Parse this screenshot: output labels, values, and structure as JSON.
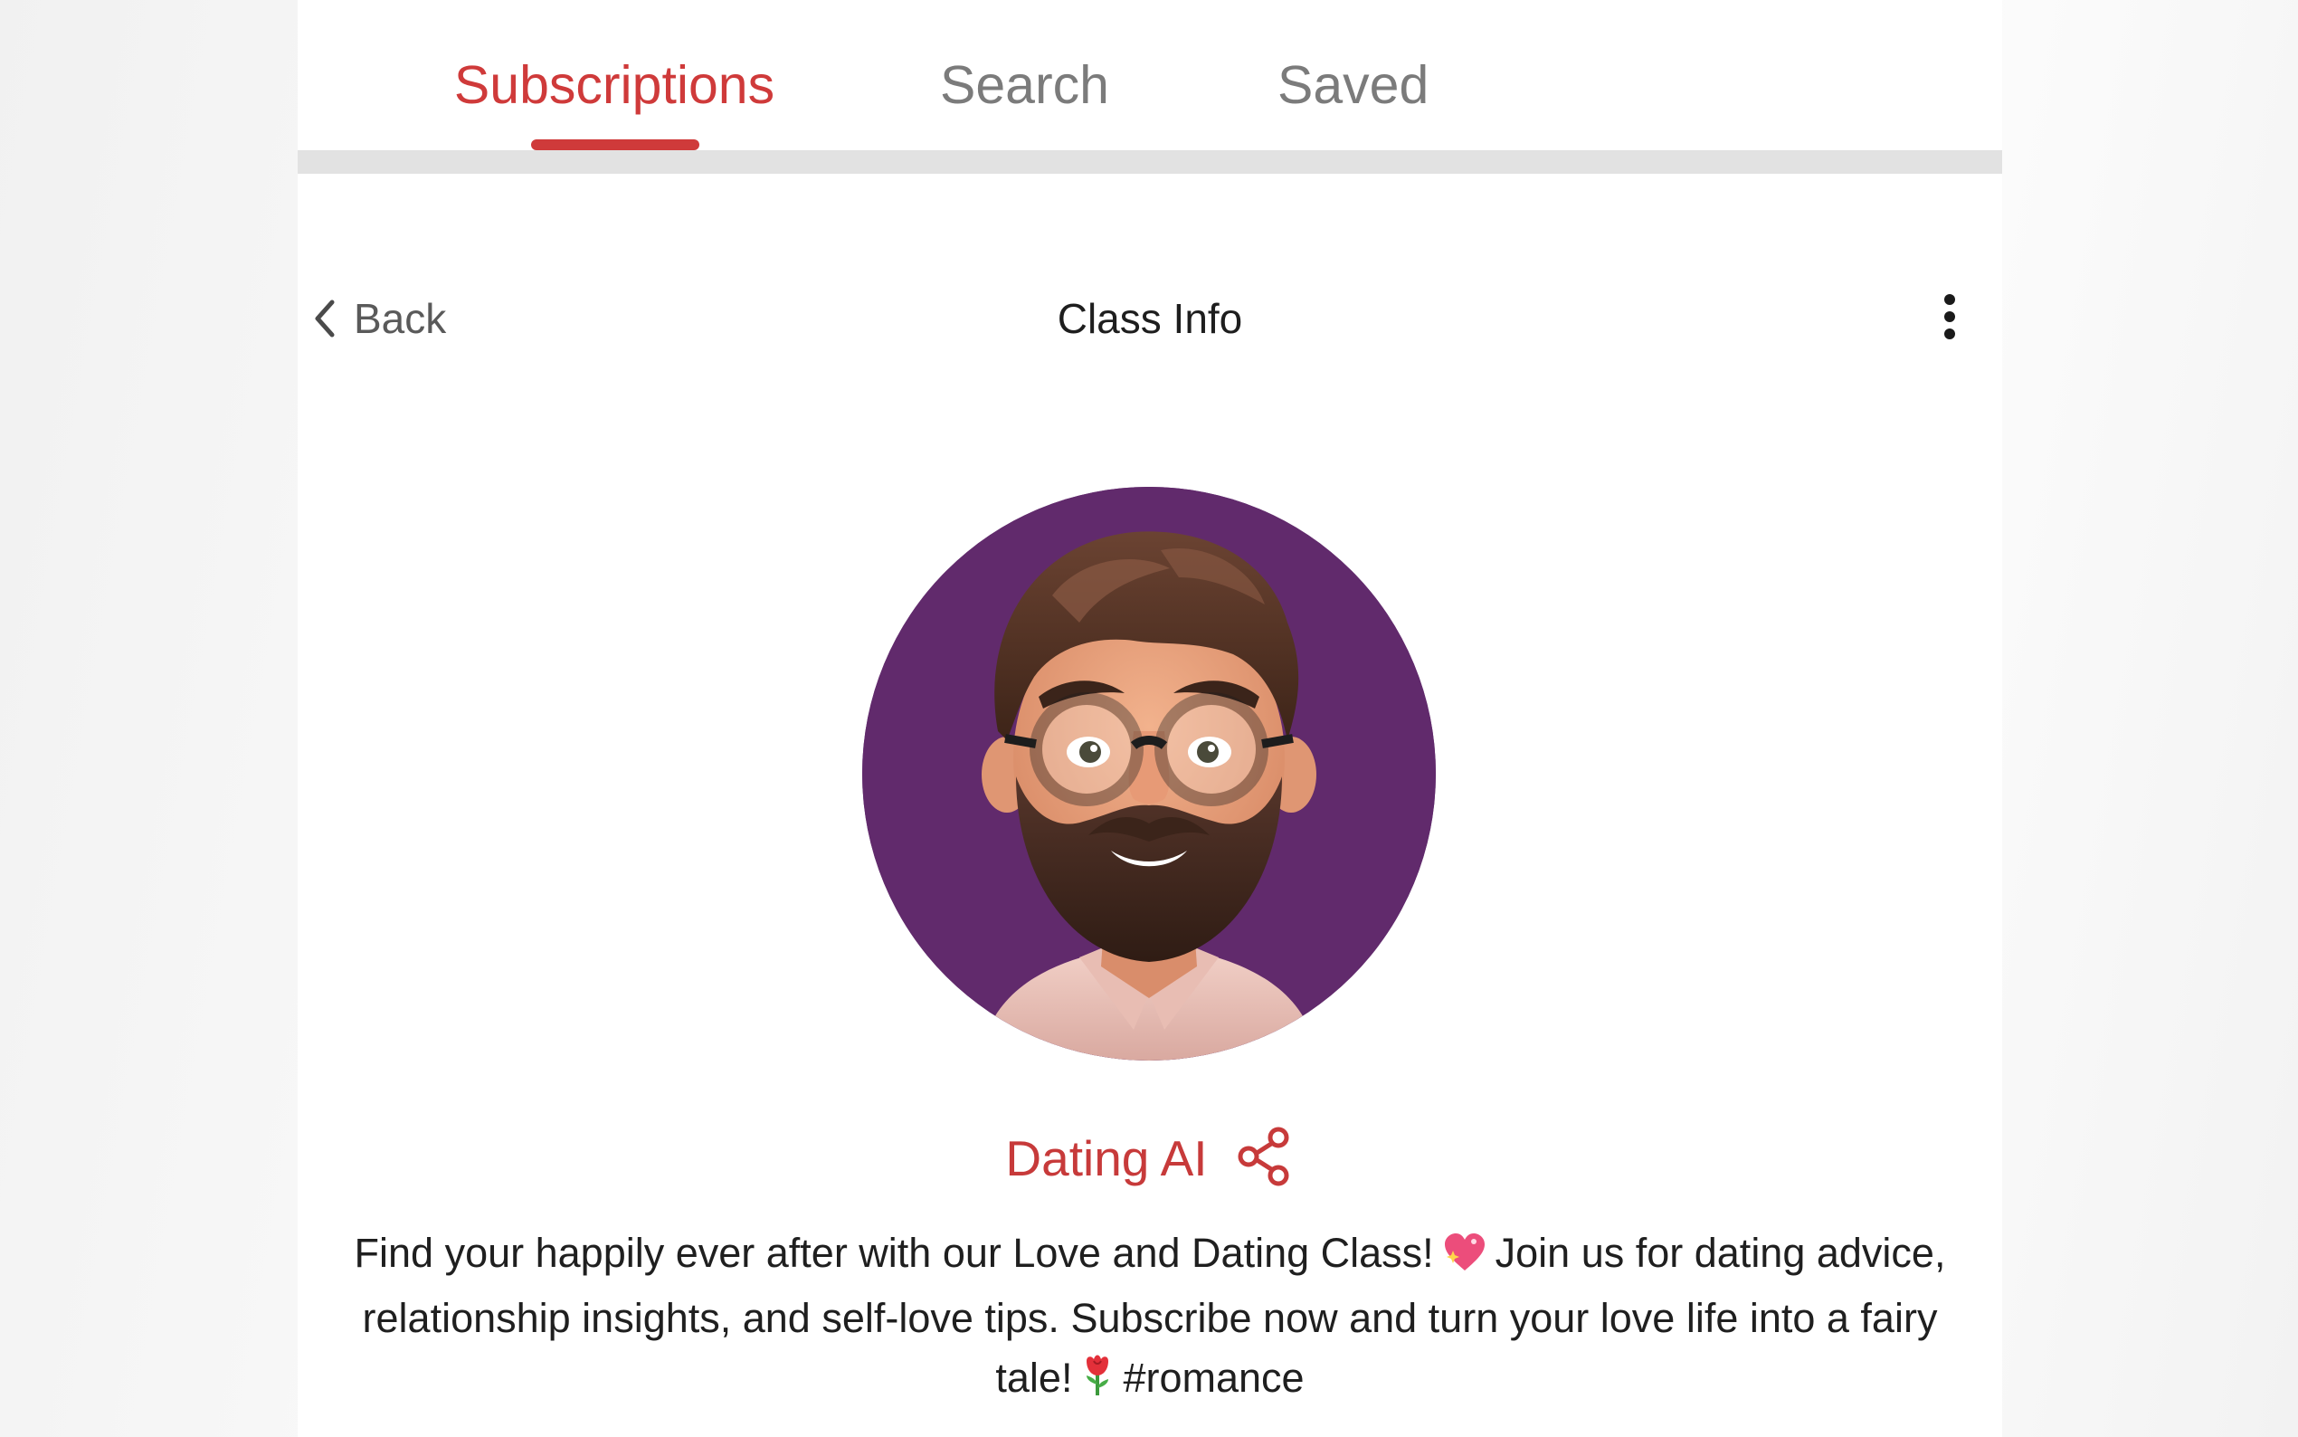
{
  "tabs": [
    {
      "label": "Subscriptions",
      "active": true
    },
    {
      "label": "Search",
      "active": false
    },
    {
      "label": "Saved",
      "active": false
    }
  ],
  "header": {
    "back_label": "Back",
    "title": "Class Info",
    "more_icon": "more-vertical-icon",
    "back_icon": "chevron-left-icon"
  },
  "class": {
    "name": "Dating AI",
    "share_icon": "share-icon",
    "avatar": "cartoon-bearded-man-with-glasses-avatar",
    "description": {
      "part1": "Find your happily ever after with our Love and Dating Class!",
      "emoji1": "sparkling-heart-emoji",
      "part2": "Join us for dating advice, relationship insights, and self-love tips. Subscribe now and turn your love life into a fairy tale!",
      "emoji2": "rose-emoji",
      "hashtag": "#romance"
    }
  },
  "colors": {
    "accent": "#cf3a3a",
    "tab_inactive": "#7b7b7b",
    "avatar_background": "#612a6c",
    "divider": "#e2e2e2"
  }
}
